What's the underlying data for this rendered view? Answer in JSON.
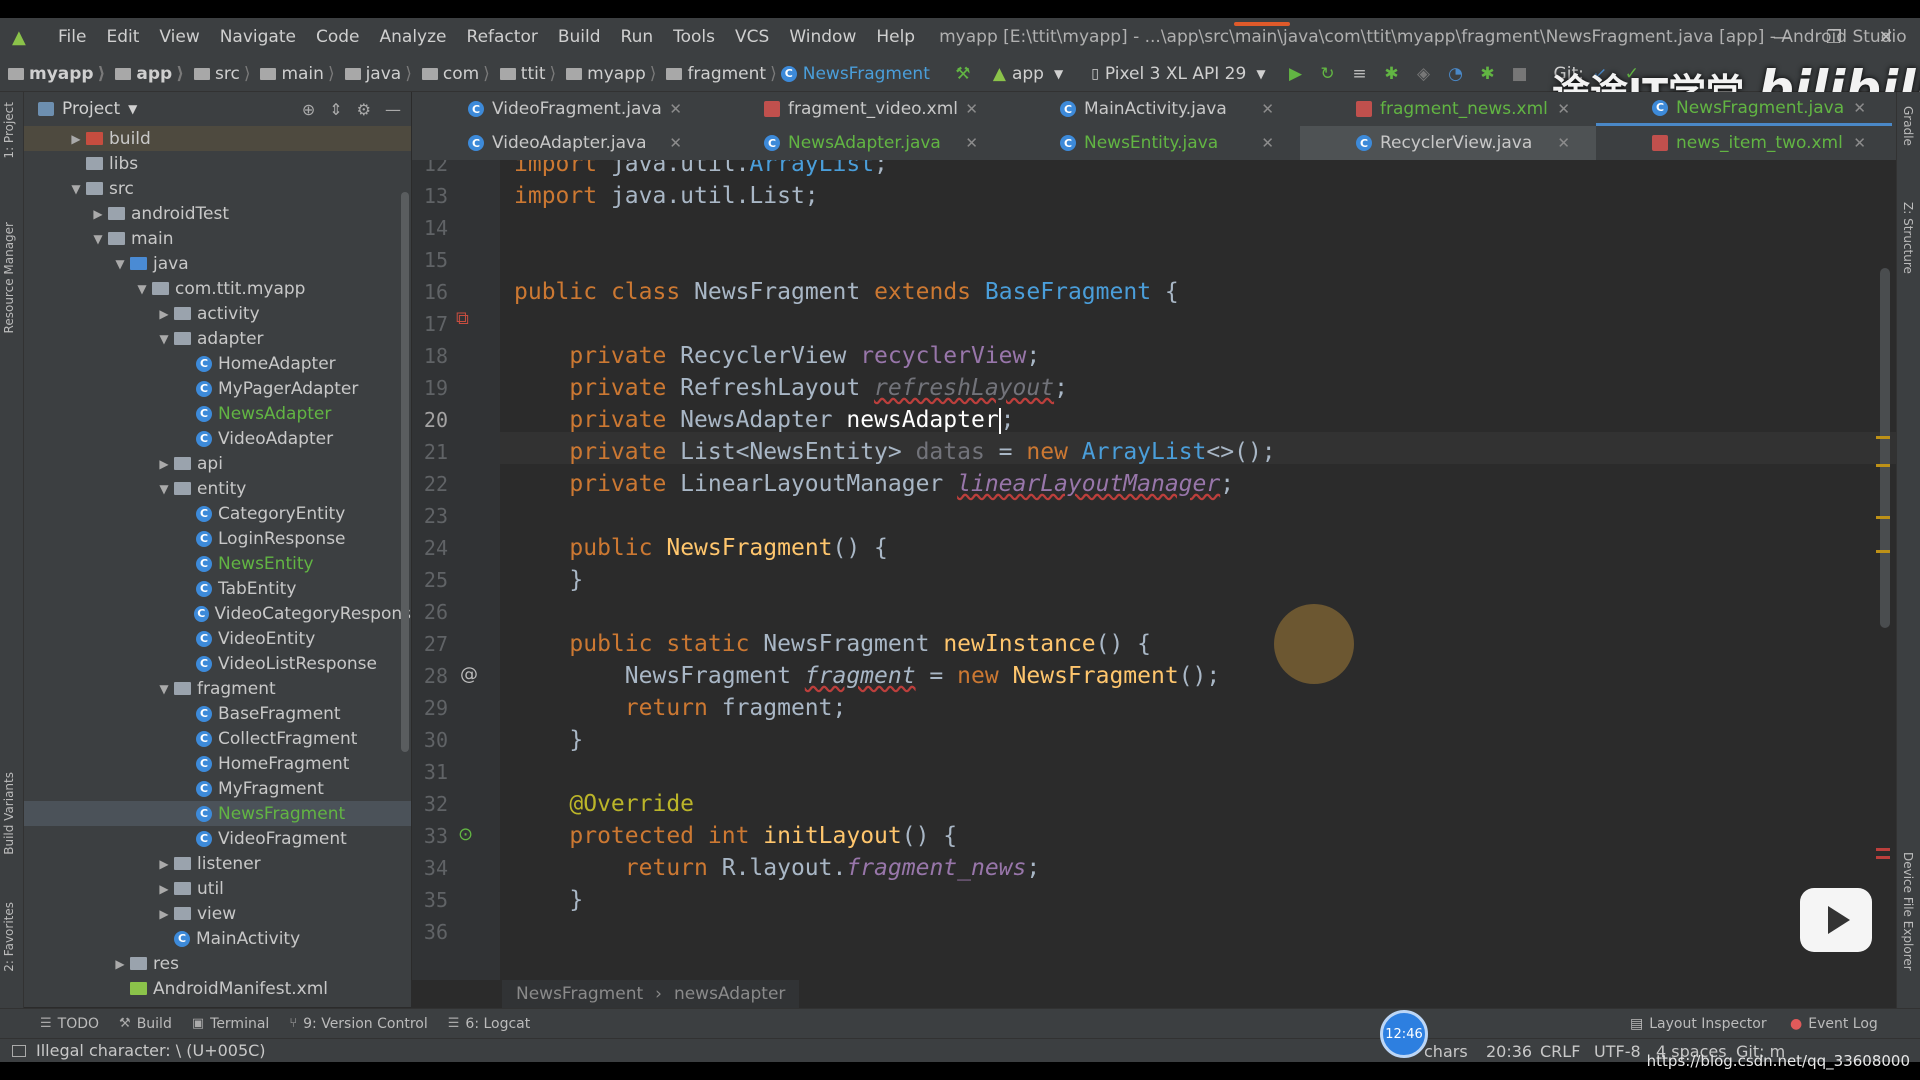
{
  "window": {
    "title": "myapp [E:\\ttit\\myapp] - ...\\app\\src\\main\\java\\com\\ttit\\myapp\\fragment\\NewsFragment.java [app] - Android Studio",
    "controls": [
      "—",
      "❐",
      "✕"
    ]
  },
  "menu": [
    "File",
    "Edit",
    "View",
    "Navigate",
    "Code",
    "Analyze",
    "Refactor",
    "Build",
    "Run",
    "Tools",
    "VCS",
    "Window",
    "Help"
  ],
  "breadcrumbs": [
    "myapp",
    "app",
    "src",
    "main",
    "java",
    "com",
    "ttit",
    "myapp",
    "fragment",
    "NewsFragment"
  ],
  "toolbar": {
    "run_config": "app",
    "device": "Pixel 3 XL API 29",
    "git_label": "Git:"
  },
  "project_panel": {
    "title": "Project",
    "tree": [
      {
        "label": "build",
        "indent": 1,
        "toggle": "▶",
        "icon": "folder-build",
        "style": "build"
      },
      {
        "label": "libs",
        "indent": 1,
        "toggle": "",
        "icon": "folder"
      },
      {
        "label": "src",
        "indent": 1,
        "toggle": "▼",
        "icon": "folder"
      },
      {
        "label": "androidTest",
        "indent": 2,
        "toggle": "▶",
        "icon": "folder"
      },
      {
        "label": "main",
        "indent": 2,
        "toggle": "▼",
        "icon": "folder"
      },
      {
        "label": "java",
        "indent": 3,
        "toggle": "▼",
        "icon": "folder-java"
      },
      {
        "label": "com.ttit.myapp",
        "indent": 4,
        "toggle": "▼",
        "icon": "package"
      },
      {
        "label": "activity",
        "indent": 5,
        "toggle": "▶",
        "icon": "package"
      },
      {
        "label": "adapter",
        "indent": 5,
        "toggle": "▼",
        "icon": "package"
      },
      {
        "label": "HomeAdapter",
        "indent": 6,
        "toggle": "",
        "icon": "class"
      },
      {
        "label": "MyPagerAdapter",
        "indent": 6,
        "toggle": "",
        "icon": "class"
      },
      {
        "label": "NewsAdapter",
        "indent": 6,
        "toggle": "",
        "icon": "class",
        "modified": true
      },
      {
        "label": "VideoAdapter",
        "indent": 6,
        "toggle": "",
        "icon": "class"
      },
      {
        "label": "api",
        "indent": 5,
        "toggle": "▶",
        "icon": "package"
      },
      {
        "label": "entity",
        "indent": 5,
        "toggle": "▼",
        "icon": "package"
      },
      {
        "label": "CategoryEntity",
        "indent": 6,
        "toggle": "",
        "icon": "class"
      },
      {
        "label": "LoginResponse",
        "indent": 6,
        "toggle": "",
        "icon": "class"
      },
      {
        "label": "NewsEntity",
        "indent": 6,
        "toggle": "",
        "icon": "class",
        "modified": true
      },
      {
        "label": "TabEntity",
        "indent": 6,
        "toggle": "",
        "icon": "class"
      },
      {
        "label": "VideoCategoryRespons",
        "indent": 6,
        "toggle": "",
        "icon": "class"
      },
      {
        "label": "VideoEntity",
        "indent": 6,
        "toggle": "",
        "icon": "class"
      },
      {
        "label": "VideoListResponse",
        "indent": 6,
        "toggle": "",
        "icon": "class"
      },
      {
        "label": "fragment",
        "indent": 5,
        "toggle": "▼",
        "icon": "package"
      },
      {
        "label": "BaseFragment",
        "indent": 6,
        "toggle": "",
        "icon": "class"
      },
      {
        "label": "CollectFragment",
        "indent": 6,
        "toggle": "",
        "icon": "class"
      },
      {
        "label": "HomeFragment",
        "indent": 6,
        "toggle": "",
        "icon": "class"
      },
      {
        "label": "MyFragment",
        "indent": 6,
        "toggle": "",
        "icon": "class"
      },
      {
        "label": "NewsFragment",
        "indent": 6,
        "toggle": "",
        "icon": "class",
        "modified": true,
        "selected": true
      },
      {
        "label": "VideoFragment",
        "indent": 6,
        "toggle": "",
        "icon": "class"
      },
      {
        "label": "listener",
        "indent": 5,
        "toggle": "▶",
        "icon": "package"
      },
      {
        "label": "util",
        "indent": 5,
        "toggle": "▶",
        "icon": "package"
      },
      {
        "label": "view",
        "indent": 5,
        "toggle": "▶",
        "icon": "package"
      },
      {
        "label": "MainActivity",
        "indent": 5,
        "toggle": "",
        "icon": "class"
      },
      {
        "label": "res",
        "indent": 3,
        "toggle": "▶",
        "icon": "folder"
      },
      {
        "label": "AndroidManifest.xml",
        "indent": 3,
        "toggle": "",
        "icon": "manifest"
      }
    ]
  },
  "tabs_row1": [
    {
      "label": "VideoFragment.java",
      "type": "java"
    },
    {
      "label": "fragment_video.xml",
      "type": "xml"
    },
    {
      "label": "MainActivity.java",
      "type": "java"
    },
    {
      "label": "fragment_news.xml",
      "type": "xml",
      "green": true
    },
    {
      "label": "NewsFragment.java",
      "type": "java",
      "green": true,
      "underline": true
    }
  ],
  "tabs_row2": [
    {
      "label": "VideoAdapter.java",
      "type": "java"
    },
    {
      "label": "NewsAdapter.java",
      "type": "java",
      "green": true
    },
    {
      "label": "NewsEntity.java",
      "type": "java",
      "green": true
    },
    {
      "label": "RecyclerView.java",
      "type": "java",
      "active": true
    },
    {
      "label": "news_item_two.xml",
      "type": "xml",
      "green": true
    }
  ],
  "editor": {
    "first_line": 12,
    "current_line": 20,
    "lines": [
      "import java.util.ArrayList;",
      "import java.util.List;",
      "",
      "",
      "public class NewsFragment extends BaseFragment {",
      "",
      "    private RecyclerView recyclerView;",
      "    private RefreshLayout refreshLayout;",
      "    private NewsAdapter newsAdapter;",
      "    private List<NewsEntity> datas = new ArrayList<>();",
      "    private LinearLayoutManager linearLayoutManager;",
      "",
      "    public NewsFragment() {",
      "    }",
      "",
      "    public static NewsFragment newInstance() {",
      "        NewsFragment fragment = new NewsFragment();",
      "        return fragment;",
      "    }",
      "",
      "    @Override",
      "    protected int initLayout() {",
      "        return R.layout.fragment_news;",
      "    }",
      ""
    ],
    "breadcrumb": [
      "NewsFragment",
      "newsAdapter"
    ]
  },
  "bottom_tools": [
    {
      "label": "TODO",
      "icon": "☰"
    },
    {
      "label": "Build",
      "icon": "⚒"
    },
    {
      "label": "Terminal",
      "icon": "▣"
    },
    {
      "label": "9: Version Control",
      "icon": "⑂"
    },
    {
      "label": "6: Logcat",
      "icon": "☰"
    }
  ],
  "bottom_right_tools": [
    {
      "label": "Layout Inspector"
    },
    {
      "label": "Event Log"
    }
  ],
  "status": {
    "message": "Illegal character: \\ (U+005C)",
    "chars": "chars",
    "position": "20:36",
    "line_sep": "CRLF",
    "encoding": "UTF-8",
    "indent": "4 spaces",
    "git": "Git: m"
  },
  "overlay": {
    "clock": "12:46",
    "brand_text": "途途IT学堂",
    "brand_logo": "bilibili",
    "url": "https://blog.csdn.net/qq_33608000"
  },
  "side_tabs": {
    "left": [
      "1: Project",
      "Resource Manager",
      "Build Variants",
      "2: Favorites"
    ],
    "right": [
      "Gradle",
      "Z: Structure",
      "Device File Explorer"
    ]
  },
  "colors": {
    "keyword": "#cc7832",
    "field": "#9876aa",
    "function": "#ffc66d",
    "annotation": "#bbb529",
    "modified_file": "#62b543",
    "accent": "#4a88c7"
  }
}
